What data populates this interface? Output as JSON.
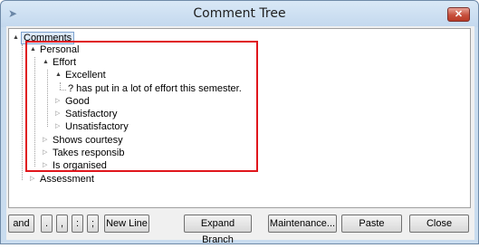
{
  "window": {
    "title": "Comment Tree",
    "close_glyph": "✕"
  },
  "tree": {
    "root": "Comments",
    "personal": "Personal",
    "effort": "Effort",
    "excellent": "Excellent",
    "comment": "? has put in a lot of effort this semester.",
    "good": "Good",
    "satisfactory": "Satisfactory",
    "unsatisfactory": "Unsatisfactory",
    "shows_courtesy": "Shows courtesy",
    "takes_responsib": "Takes responsib",
    "is_organised": "Is organised",
    "assessment": "Assessment"
  },
  "buttons": {
    "and": "and",
    "period": ".",
    "comma": ",",
    "colon": ":",
    "semicolon": ";",
    "new_line": "New Line",
    "expand_branch": "Expand Branch",
    "maintenance": "Maintenance...",
    "paste": "Paste",
    "close": "Close"
  },
  "icons": {
    "expanded": "▲",
    "collapsed": "▷"
  },
  "colors": {
    "highlight": "#e0161c",
    "selection": "#dde9f7"
  }
}
